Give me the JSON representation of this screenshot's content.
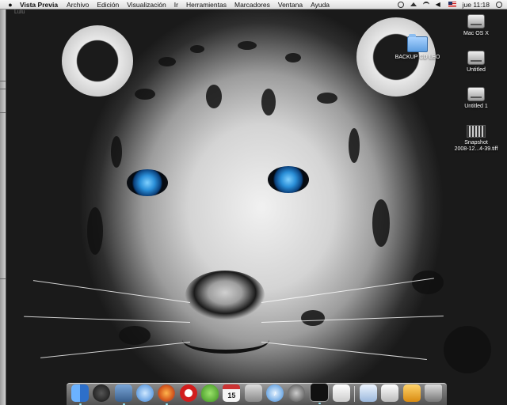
{
  "menubar": {
    "app_name": "Vista Previa",
    "items": [
      "Archivo",
      "Edición",
      "Visualización",
      "Ir",
      "Herramientas",
      "Marcadores",
      "Ventana",
      "Ayuda"
    ],
    "time": "jue 11:18"
  },
  "window": {
    "title": "Lulu"
  },
  "desktop_icons": [
    {
      "label": "Mac OS X",
      "kind": "drive"
    },
    {
      "label": "BACKUP CD LEO",
      "kind": "folder"
    },
    {
      "label": "Untitled",
      "kind": "drive"
    },
    {
      "label": "Untitled 1",
      "kind": "drive"
    },
    {
      "label": "Snapshot",
      "label2": "2008-12...4-39.tiff",
      "kind": "snapshot"
    }
  ],
  "dock": {
    "calendar_day": "15",
    "apps": [
      "finder-icon",
      "dashboard-icon",
      "preview-icon",
      "safari-icon",
      "firefox-icon",
      "opera-icon",
      "adium-icon",
      "ical-icon",
      "iphoto-icon",
      "itunes-icon",
      "dvd-player-icon",
      "terminal-icon",
      "textedit-icon",
      "downloads-icon",
      "documents-icon",
      "stack-icon",
      "trash-icon"
    ]
  },
  "colors": {
    "eye_blue": "#2a8fd8",
    "menubar_bg": "#f0f0f0"
  }
}
